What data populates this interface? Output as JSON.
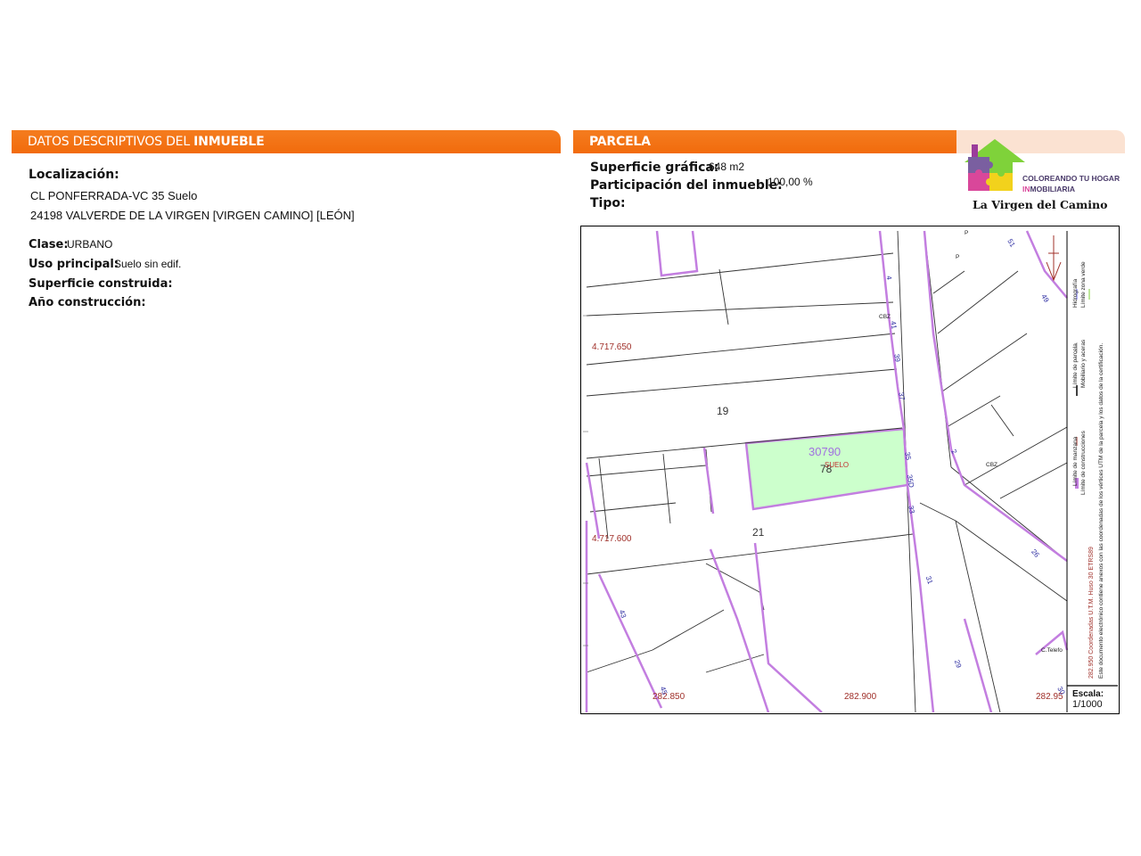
{
  "left_section": {
    "title_prefix": "DATOS DESCRIPTIVOS DEL ",
    "title_bold": "INMUEBLE",
    "localizacion_label": "Localización:",
    "address_line1": "CL PONFERRADA-VC 35 Suelo",
    "address_line2": "24198 VALVERDE DE LA VIRGEN [VIRGEN CAMINO] [LEÓN]",
    "clase_label": "Clase:",
    "clase_value": "URBANO",
    "uso_label": "Uso principal:",
    "uso_value": "Suelo sin edif.",
    "superficie_construida_label": "Superficie construida:",
    "anio_label": "Año construcción:"
  },
  "right_section": {
    "title": "PARCELA",
    "superficie_grafica_label": "Superficie gráfica:",
    "superficie_grafica_value": "648 m2",
    "participacion_label": "Participación del inmueble:",
    "participacion_value": "100,00 %",
    "tipo_label": "Tipo:"
  },
  "logo": {
    "line1": "COLOREANDO TU HOGAR",
    "line2_accent": "IN",
    "line2_rest": "MOBILIARIA",
    "tagline": "La Virgen del Camino"
  },
  "map": {
    "parcel_id": "30790",
    "parcel_number": "78",
    "parcel_use": "SUELO",
    "block_19": "19",
    "block_21": "21",
    "coord_y1": "4.717.650",
    "coord_y2": "4.717.600",
    "coord_x1": "282.850",
    "coord_x2": "282.900",
    "coord_x3": "282.95",
    "cbz1": "CBZ",
    "cbz2": "CBZ",
    "p1": "P",
    "p2": "P",
    "telefo": "C.Telefo",
    "num_4": "4",
    "num_41": "41",
    "num_39": "39",
    "num_37": "37",
    "num_35": "35",
    "num_35d": "35D",
    "num_33": "33",
    "num_31": "31",
    "num_29": "29",
    "num_2": "2",
    "num_26": "26",
    "num_43": "43",
    "num_45": "45",
    "num_51": "51",
    "num_49": "49",
    "num_30": "30",
    "escala_label": "Escala:",
    "escala_value": "1/1000",
    "legend_manzana": "Límite de manzana",
    "legend_parcela": "Límite de parcela",
    "legend_hidrografia": "Hidrografía",
    "legend_construcciones": "Límite de construcciones",
    "legend_mobiliario": "Mobiliario y aceras",
    "legend_zona_verde": "Límite zona verde",
    "legend_coords": "282.950 Coordenadas U.T.M. Huso 30 ETRS89",
    "legend_note": "Este documento electrónico contiene anexos con las coordenadas de los vértices UTM de la parcela y los datos de la certificación."
  },
  "colors": {
    "orange": "#f26b0c",
    "parcel_fill": "#ccffcc",
    "violet_line": "#c37ee0",
    "coord_red": "#a0302a",
    "house_numbers": "#2a2aa0"
  }
}
